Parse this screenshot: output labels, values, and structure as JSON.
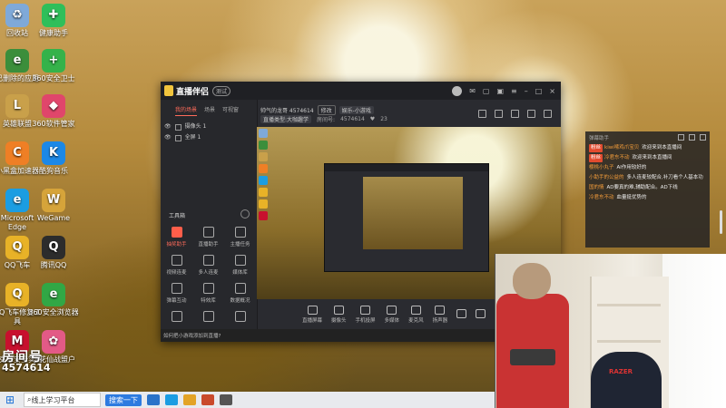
{
  "desktop": {
    "icons": [
      {
        "label": "回收站",
        "color": "#7fa9d8",
        "glyph": "♻",
        "icon": "recycle-bin-icon"
      },
      {
        "label": "健康助手",
        "color": "#2fbf5a",
        "glyph": "✚",
        "icon": "health-assistant-icon"
      },
      {
        "label": "已删除的应用",
        "color": "#3b8e3b",
        "glyph": "e",
        "icon": "deleted-apps-icon"
      },
      {
        "label": "360安全卫士",
        "color": "#35b24a",
        "glyph": "+",
        "icon": "360-security-icon"
      },
      {
        "label": "英雄联盟",
        "color": "#c9a04a",
        "glyph": "L",
        "icon": "league-of-legends-icon"
      },
      {
        "label": "360软件管家",
        "color": "#e0466b",
        "glyph": "◆",
        "icon": "360-software-manager-icon"
      },
      {
        "label": "小黑盒加速器",
        "color": "#ef7f25",
        "glyph": "C",
        "icon": "xiaoheihe-accelerator-icon"
      },
      {
        "label": "酷狗音乐",
        "color": "#1c88e6",
        "glyph": "K",
        "icon": "kugou-music-icon"
      },
      {
        "label": "Microsoft Edge",
        "color": "#1b9de2",
        "glyph": "e",
        "icon": "edge-icon"
      },
      {
        "label": "WeGame",
        "color": "#d6a43a",
        "glyph": "W",
        "icon": "wegame-icon"
      },
      {
        "label": "QQ飞车",
        "color": "#e8b227",
        "glyph": "Q",
        "icon": "qq-speed-icon"
      },
      {
        "label": "腾讯QQ",
        "color": "#2c2c2c",
        "glyph": "Q",
        "icon": "qq-icon"
      },
      {
        "label": "QQ飞车修复工具",
        "color": "#e8b227",
        "glyph": "Q",
        "icon": "qq-speed-repair-icon"
      },
      {
        "label": "360安全浏览器",
        "color": "#31a745",
        "glyph": "e",
        "icon": "360-browser-icon"
      },
      {
        "label": "迈克菲安全实用",
        "color": "#c8102e",
        "glyph": "M",
        "icon": "mcafee-icon"
      },
      {
        "label": "小花仙战盟户",
        "color": "#e35a86",
        "glyph": "✿",
        "icon": "xiaohuaxian-icon"
      }
    ],
    "watermark": {
      "label": "房间号",
      "room": "4574614"
    }
  },
  "taskbar": {
    "search_text": "线上学习平台",
    "search_button": "搜索一下"
  },
  "app": {
    "name": "直播伴侣",
    "version": "测试",
    "tabs": [
      "我的场景",
      "场景",
      "可视窗"
    ],
    "layers": [
      "摄像头 1",
      "全屏 1"
    ],
    "tools_title": "工具箱",
    "tools": [
      "抽奖助手",
      "直播助手",
      "主播任务",
      "视频连麦",
      "多人连麦",
      "媒体库",
      "弹幕互动",
      "特效库",
      "数据概况",
      "",
      "",
      ""
    ],
    "tip": "如何把小游戏添加到直播?",
    "room_title": "帅气的龙哥 4574614",
    "edit": "修改",
    "category": "娱乐-小游戏",
    "category_sub": "直播类型:大咖趣学",
    "room_label": "房间号:",
    "room_id": "4574614",
    "likes": "23",
    "controls": [
      "直播屏幕",
      "摄像头",
      "手机投屏",
      "多媒体",
      "麦克风",
      "扬声器",
      "",
      "",
      ""
    ],
    "status": [
      "",
      "",
      ""
    ]
  },
  "chat": {
    "header": "弹幕助手",
    "messages": [
      {
        "badge": "粉丝",
        "user": "kiwi嗦鸡爪宝贝",
        "text": "欢迎来到本直播间"
      },
      {
        "badge": "粉丝",
        "user": "冷君东不动",
        "text": "欢迎来到本直播间"
      },
      {
        "badge": "",
        "user": "樱桃小丸子",
        "text": "AI作用较好的"
      },
      {
        "badge": "",
        "user": "小助手的公益的",
        "text": "多人连麦较配合,补刀看个人基本功"
      },
      {
        "badge": "",
        "user": "国的情",
        "text": "AD要真的难,辅助配合。AD下线"
      },
      {
        "badge": "",
        "user": "冷君东不动",
        "text": "血量挺优势的"
      }
    ]
  },
  "camera": {
    "chair_logo": "RAZER"
  },
  "colors": {
    "accent": "#ff5e4a",
    "app_bg": "#2a2b30",
    "chat_badge": "#e24b2f"
  }
}
